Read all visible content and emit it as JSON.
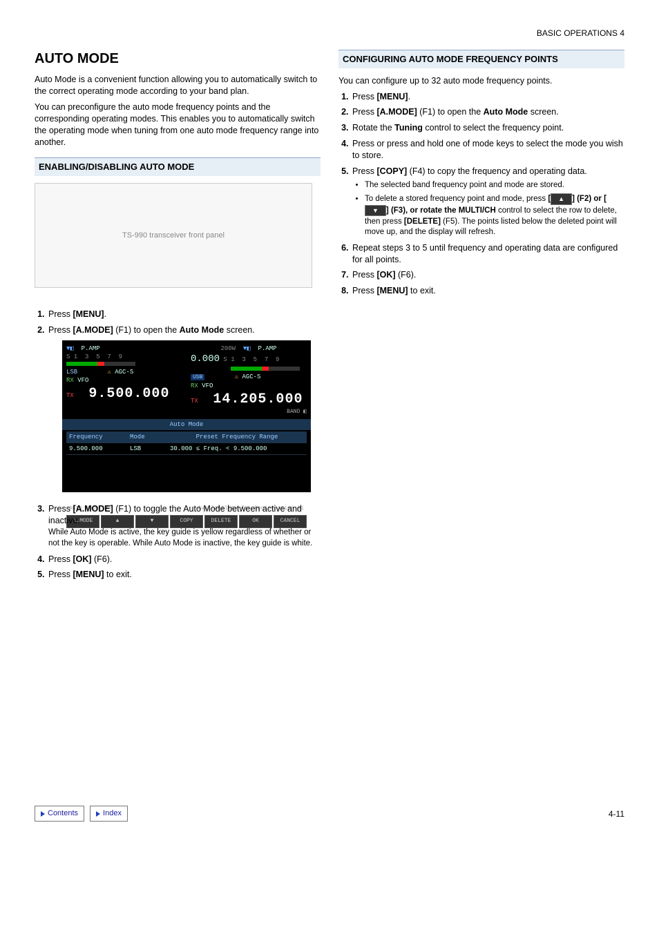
{
  "header": {
    "right": "BASIC OPERATIONS 4"
  },
  "left": {
    "title": "AUTO MODE",
    "intro1": "Auto Mode is a convenient function allowing you to automatically switch to the correct operating mode according to your band plan.",
    "intro2": "You can preconfigure the auto mode frequency points and the corresponding operating modes. This enables you to automatically switch the operating mode when tuning from one auto mode frequency range into another.",
    "section1": "ENABLING/DISABLING AUTO MODE",
    "radio_alt": "TS-990 transceiver front panel",
    "steps1": {
      "s1_pre": "Press ",
      "s1_b": "[MENU]",
      "s1_post": ".",
      "s2_pre": "Press ",
      "s2_b": "[A.MODE]",
      "s2_mid": " (F1) to open the ",
      "s2_b2": "Auto Mode",
      "s2_end": " screen.",
      "s3_pre": "Press ",
      "s3_b": "[A.MODE]",
      "s3_post": " (F1) to toggle the Auto Mode between active and inactive.",
      "s3_note": "While Auto Mode is active, the key guide is yellow regardless of whether or not the key is operable. While Auto Mode is inactive, the key guide is white.",
      "s4_pre": "Press ",
      "s4_b": "[OK]",
      "s4_post": " (F6).",
      "s5_pre": "Press ",
      "s5_b": "[MENU]",
      "s5_post": " to exit."
    },
    "screen": {
      "pamp": "P.AMP",
      "lsb": "LSB",
      "usb": "USB",
      "rx": "RX",
      "tx": "TX",
      "vfo": "VFO",
      "agc": "AGC-S",
      "power": "200W",
      "zero": "0.000",
      "f1": "9.500.000",
      "f2": "14.205.000",
      "band": "BAND",
      "title": "Auto Mode",
      "h1": "Frequency",
      "h2": "Mode",
      "h3": "Preset Frequency Range",
      "r1a": "9.500.000",
      "r1b": "LSB",
      "r1c": "30.000  ≤  Freq.  <    9.500.000",
      "status_l": "Auto Mode Off",
      "status_r": "Availability for Registration 31",
      "btn1": "A.MODE",
      "btn2": "▲",
      "btn3": "▼",
      "btn4": "COPY",
      "btn5": "DELETE",
      "btn6": "OK",
      "btn7": "CANCEL"
    }
  },
  "right": {
    "section2": "CONFIGURING AUTO MODE FREQUENCY POINTS",
    "intro": "You can configure up to 32 auto mode frequency points.",
    "steps": {
      "s1_pre": "Press ",
      "s1_b": "[MENU]",
      "s1_post": ".",
      "s2_pre": "Press ",
      "s2_b": "[A.MODE]",
      "s2_mid": " (F1) to open the ",
      "s2_b2": "Auto Mode",
      "s2_end": " screen.",
      "s3_pre": "Rotate the ",
      "s3_b": "Tuning",
      "s3_post": " control to select the frequency point.",
      "s4": "Press or press and hold one of mode keys to select the mode you wish to store.",
      "s5_pre": "Press ",
      "s5_b": "[COPY]",
      "s5_post": " (F4) to copy the frequency and operating data.",
      "s5_bul1": "The selected band frequency point and mode are stored.",
      "s5_bul2_a": "To delete a stored frequency point and mode, press ",
      "s5_bul2_b": "[",
      "s5_bul2_c": "] (F2) or [",
      "s5_bul2_d": "] (F3), or rotate the ",
      "s5_bul2_e": "MULTI/CH",
      "s5_bul2_f": " control to select the row to delete, then press ",
      "s5_bul2_g": "[DELETE]",
      "s5_bul2_h": " (F5). The points listed below the deleted point will move up, and the display will refresh.",
      "s6": "Repeat steps 3 to 5 until frequency and operating data are configured for all points.",
      "s7_pre": "Press ",
      "s7_b": "[OK]",
      "s7_post": " (F6).",
      "s8_pre": "Press ",
      "s8_b": "[MENU]",
      "s8_post": " to exit."
    }
  },
  "footer": {
    "contents": "Contents",
    "index": "Index",
    "page": "4-11"
  }
}
